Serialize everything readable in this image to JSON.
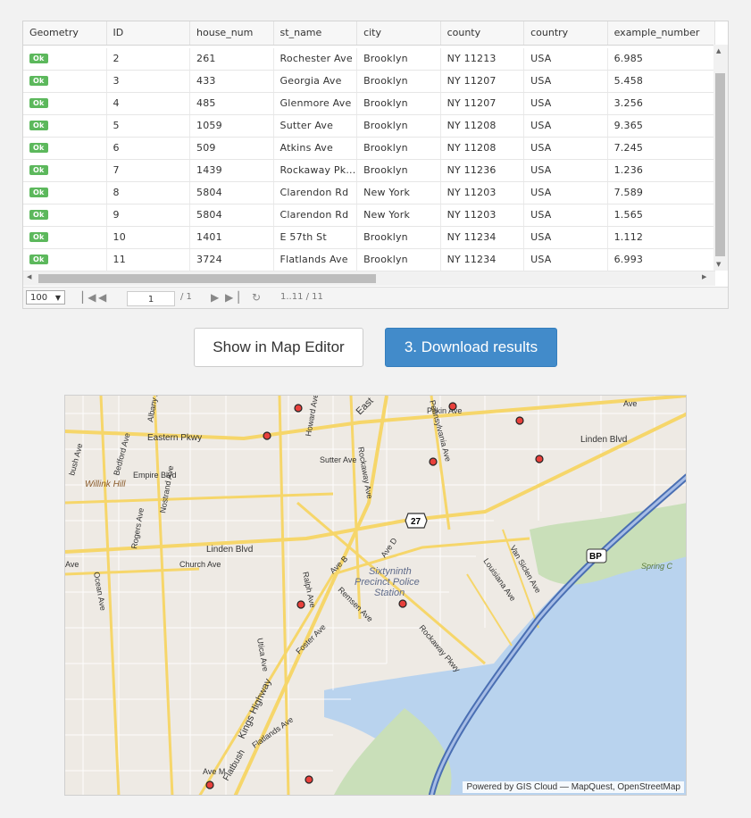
{
  "grid": {
    "columns": [
      "Geometry",
      "ID",
      "house_num",
      "st_name",
      "city",
      "county",
      "country",
      "example_number"
    ],
    "rows": [
      {
        "geometry": "Ok",
        "id": "2",
        "house_num": "261",
        "st_name": "Rochester Ave",
        "city": "Brooklyn",
        "county": "NY 11213",
        "country": "USA",
        "example_number": "6.985"
      },
      {
        "geometry": "Ok",
        "id": "3",
        "house_num": "433",
        "st_name": "Georgia Ave",
        "city": "Brooklyn",
        "county": "NY 11207",
        "country": "USA",
        "example_number": "5.458"
      },
      {
        "geometry": "Ok",
        "id": "4",
        "house_num": "485",
        "st_name": "Glenmore Ave",
        "city": "Brooklyn",
        "county": "NY 11207",
        "country": "USA",
        "example_number": "3.256"
      },
      {
        "geometry": "Ok",
        "id": "5",
        "house_num": "1059",
        "st_name": "Sutter Ave",
        "city": "Brooklyn",
        "county": "NY 11208",
        "country": "USA",
        "example_number": "9.365"
      },
      {
        "geometry": "Ok",
        "id": "6",
        "house_num": "509",
        "st_name": "Atkins Ave",
        "city": "Brooklyn",
        "county": "NY 11208",
        "country": "USA",
        "example_number": "7.245"
      },
      {
        "geometry": "Ok",
        "id": "7",
        "house_num": "1439",
        "st_name": "Rockaway Pk...",
        "city": "Brooklyn",
        "county": "NY 11236",
        "country": "USA",
        "example_number": "1.236"
      },
      {
        "geometry": "Ok",
        "id": "8",
        "house_num": "5804",
        "st_name": "Clarendon Rd",
        "city": "New York",
        "county": "NY 11203",
        "country": "USA",
        "example_number": "7.589"
      },
      {
        "geometry": "Ok",
        "id": "9",
        "house_num": "5804",
        "st_name": "Clarendon Rd",
        "city": "New York",
        "county": "NY 11203",
        "country": "USA",
        "example_number": "1.565"
      },
      {
        "geometry": "Ok",
        "id": "10",
        "house_num": "1401",
        "st_name": "E 57th St",
        "city": "Brooklyn",
        "county": "NY 11234",
        "country": "USA",
        "example_number": "1.112"
      },
      {
        "geometry": "Ok",
        "id": "11",
        "house_num": "3724",
        "st_name": "Flatlands Ave",
        "city": "Brooklyn",
        "county": "NY 11234",
        "country": "USA",
        "example_number": "6.993"
      }
    ]
  },
  "pager": {
    "page_size": "100",
    "page_input": "1",
    "page_total": "/ 1",
    "range": "1..11 / 11"
  },
  "buttons": {
    "map_editor": "Show in Map Editor",
    "download": "3. Download results"
  },
  "map": {
    "attribution": "Powered by GIS Cloud — MapQuest, OpenStreetMap",
    "labels": {
      "eastern_pkwy": "Eastern Pkwy",
      "linden_blvd_w": "Linden Blvd",
      "linden_blvd_e": "Linden Blvd",
      "sutter_ave": "Sutter Ave",
      "empire_blvd": "Empire Blvd",
      "church_ave": "Church Ave",
      "willink_hill": "Willink Hill",
      "bedford_ave": "Bedford Ave",
      "nostrand_ave": "Nostrand Ave",
      "rogers_ave": "Rogers Ave",
      "albany_ave": "Albany Ave",
      "ocean_ave": "Ocean Ave",
      "utica_ave": "Utica Ave",
      "ralph_ave": "Ralph Ave",
      "remsen_ave": "Remsen Ave",
      "foster_ave": "Foster Ave",
      "flatlands_ave": "Flatlands Ave",
      "kings_highway": "Kings Highway",
      "rockaway_pkwy": "Rockaway Pkwy",
      "rockaway_ave": "Rockaway Ave",
      "pennsylvania_ave": "Pennsylvania Ave",
      "pitkin_ave": "Pitkin Ave",
      "howard_ave": "Howard Ave",
      "ave_b": "Ave B",
      "ave_d": "Ave D",
      "ave_m": "Ave M",
      "flatbush": "Flatbush",
      "van_siclen_ave": "Van Siclen Ave",
      "louisiana_ave": "Louisiana Ave",
      "spring_creek": "Spring C",
      "precinct_1": "Sixtyninth",
      "precinct_2": "Precinct Police",
      "precinct_3": "Station",
      "shield_27": "27",
      "shield_bp": "BP",
      "east": "East",
      "ave_left": "Ave",
      "bush_ave": "bush Ave",
      "ave_top": "Ave"
    }
  },
  "colors": {
    "ok_badge": "#5cb85c",
    "primary_button": "#428bca",
    "marker_fill": "#e8413c",
    "water": "#b9d3ee",
    "major_road": "#f6d66a"
  }
}
